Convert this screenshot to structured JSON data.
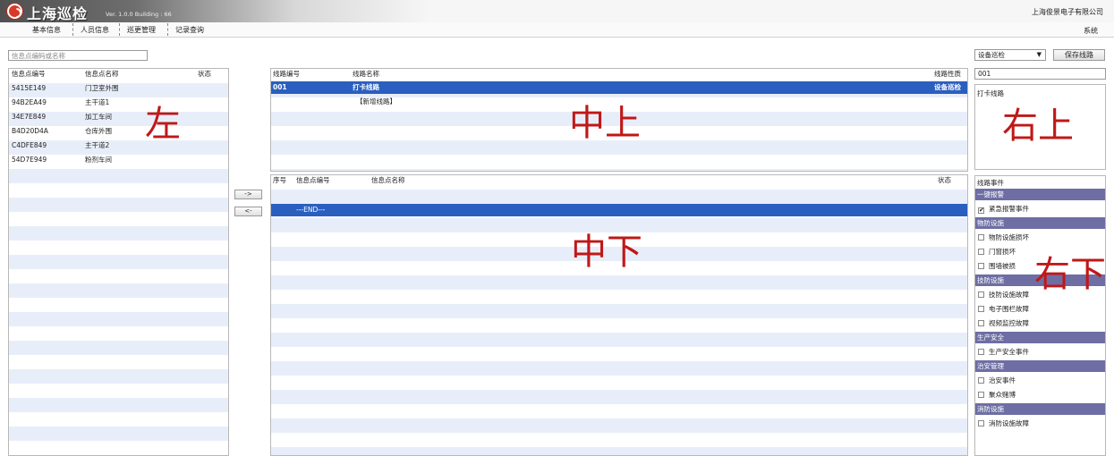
{
  "app": {
    "title": "上海巡检",
    "version": "Ver. 1.0.0 Building : 66",
    "company": "上海俊景电子有限公司"
  },
  "menu": {
    "items": [
      "基本信息",
      "人员信息",
      "巡更管理",
      "记录查询"
    ],
    "system": "系统"
  },
  "left": {
    "search_placeholder": "信息点编码或名称",
    "columns": [
      "信息点编号",
      "信息点名称",
      "状态"
    ],
    "rows": [
      {
        "code": "5415E149",
        "name": "门卫室外围"
      },
      {
        "code": "94B2EA49",
        "name": "主干道1"
      },
      {
        "code": "34E7E849",
        "name": "加工车间"
      },
      {
        "code": "B4D20D4A",
        "name": "仓库外围"
      },
      {
        "code": "C4DFE849",
        "name": "主干道2"
      },
      {
        "code": "54D7E949",
        "name": "粉剂车间"
      }
    ],
    "overlay": "左"
  },
  "transfer": {
    "add": "->",
    "remove": "<-"
  },
  "mid_top": {
    "columns": [
      "线路编号",
      "线路名称",
      "线路性质"
    ],
    "rows": [
      {
        "code": "001",
        "name": "打卡线路",
        "type": "设备巡检"
      }
    ],
    "new_route": "【新增线路】",
    "overlay": "中上"
  },
  "mid_bottom": {
    "columns": [
      "序号",
      "信息点编号",
      "信息点名称",
      "状态"
    ],
    "end_row": "---END---",
    "overlay": "中下"
  },
  "right": {
    "type_select": "设备巡检",
    "save_button": "保存线路",
    "route_code": "001",
    "route_name": "打卡线路",
    "overlay_top": "右上",
    "events_title": "线路事件",
    "overlay_bottom": "右下",
    "groups": [
      {
        "name": "一键报警",
        "items": [
          {
            "label": "紧急报警事件",
            "checked": true
          }
        ]
      },
      {
        "name": "物防设施",
        "items": [
          {
            "label": "物防设施损坏",
            "checked": false
          },
          {
            "label": "门窗损坏",
            "checked": false
          },
          {
            "label": "围墙被损",
            "checked": false
          }
        ]
      },
      {
        "name": "技防设施",
        "items": [
          {
            "label": "技防设施故障",
            "checked": false
          },
          {
            "label": "电子围栏故障",
            "checked": false
          },
          {
            "label": "视频监控故障",
            "checked": false
          }
        ]
      },
      {
        "name": "生产安全",
        "items": [
          {
            "label": "生产安全事件",
            "checked": false
          }
        ]
      },
      {
        "name": "治安管理",
        "items": [
          {
            "label": "治安事件",
            "checked": false
          },
          {
            "label": "聚众赌博",
            "checked": false
          }
        ]
      },
      {
        "name": "消防设施",
        "items": [
          {
            "label": "消防设施故障",
            "checked": false
          }
        ]
      }
    ]
  }
}
